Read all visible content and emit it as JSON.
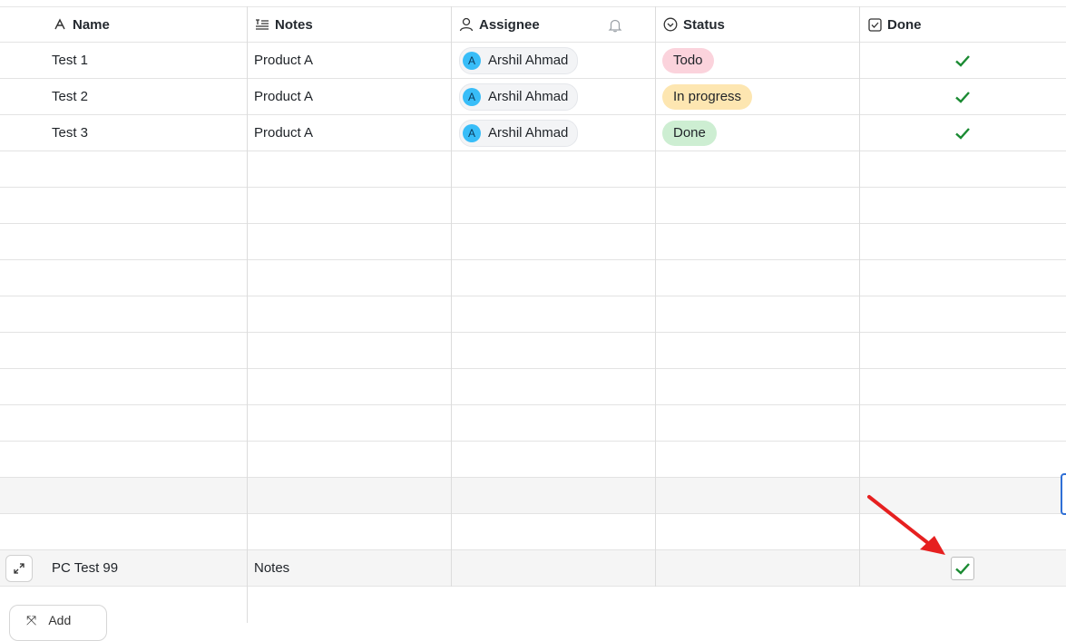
{
  "columns": {
    "name": "Name",
    "notes": "Notes",
    "assignee": "Assignee",
    "status": "Status",
    "done": "Done"
  },
  "rows": [
    {
      "name": "Test 1",
      "notes": "Product A",
      "assignee": "Arshil Ahmad",
      "avatar_initial": "A",
      "status": "Todo",
      "status_color": "#fbd3dc",
      "done": true
    },
    {
      "name": "Test 2",
      "notes": "Product A",
      "assignee": "Arshil Ahmad",
      "avatar_initial": "A",
      "status": "In progress",
      "status_color": "#fde6b1",
      "done": true
    },
    {
      "name": "Test 3",
      "notes": "Product A",
      "assignee": "Arshil Ahmad",
      "avatar_initial": "A",
      "status": "Done",
      "status_color": "#cdeed2",
      "done": true
    }
  ],
  "new_row": {
    "name": "PC Test 99",
    "notes": "Notes",
    "done": true
  },
  "add_tab_label": "Add",
  "colors": {
    "check": "#1a8a32",
    "avatar": "#38bdf8",
    "arrow": "#e62020",
    "selection": "#2f6fd6"
  },
  "icons": [
    "text-type-icon",
    "notes-icon",
    "person-icon",
    "bell-icon",
    "status-circle-icon",
    "checkbox-icon",
    "checkmark-icon",
    "expand-icon",
    "annotation-arrow-icon"
  ]
}
